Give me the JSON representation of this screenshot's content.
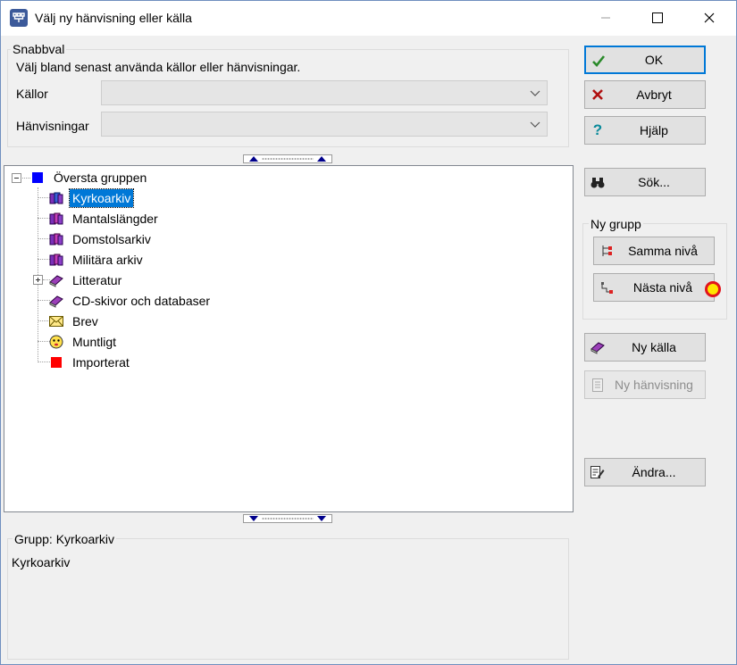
{
  "window": {
    "title": "Välj ny hänvisning eller källa"
  },
  "snabbval": {
    "legend": "Snabbval",
    "description": "Välj bland senast använda källor eller hänvisningar.",
    "kallor_label": "Källor",
    "kallor_value": "",
    "hanvisningar_label": "Hänvisningar",
    "hanvisningar_value": ""
  },
  "tree": {
    "root": "Översta gruppen",
    "items": [
      {
        "label": "Kyrkoarkiv",
        "icon": "books-icon",
        "selected": true
      },
      {
        "label": "Mantalslängder",
        "icon": "books-icon"
      },
      {
        "label": "Domstolsarkiv",
        "icon": "books-icon"
      },
      {
        "label": "Militära arkiv",
        "icon": "books-icon"
      },
      {
        "label": "Litteratur",
        "icon": "book-icon",
        "expandable": true
      },
      {
        "label": "CD-skivor och databaser",
        "icon": "book-icon"
      },
      {
        "label": "Brev",
        "icon": "envelope-icon"
      },
      {
        "label": "Muntligt",
        "icon": "face-icon"
      },
      {
        "label": "Importerat",
        "icon": "red-square-icon"
      }
    ]
  },
  "info": {
    "legend": "Grupp: Kyrkoarkiv",
    "text": "Kyrkoarkiv"
  },
  "buttons": {
    "ok": "OK",
    "avbryt": "Avbryt",
    "hjalp": "Hjälp",
    "sok": "Sök...",
    "ny_grupp_legend": "Ny grupp",
    "samma_niva": "Samma nivå",
    "nasta_niva": "Nästa nivå",
    "ny_kalla": "Ny källa",
    "ny_hanvisning": "Ny hänvisning",
    "andra": "Ändra..."
  },
  "colors": {
    "accent": "#0078d7",
    "root_square": "#0000ff",
    "importerat_square": "#ff0000"
  }
}
